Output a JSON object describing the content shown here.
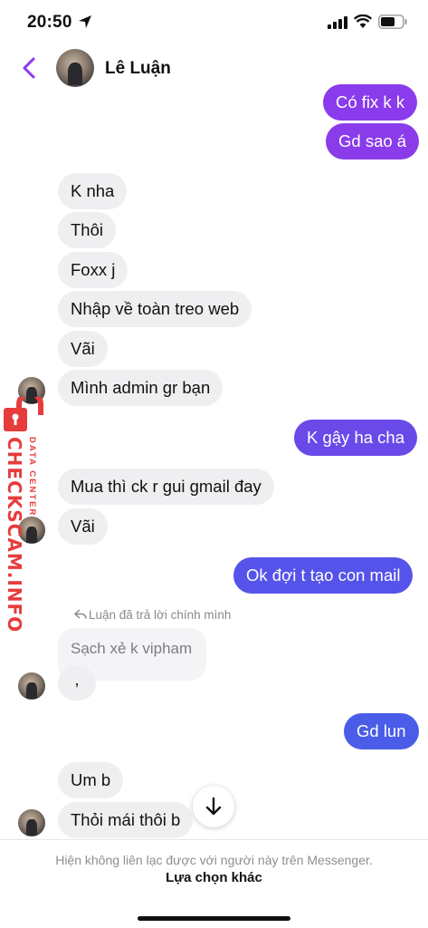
{
  "status_bar": {
    "time": "20:50"
  },
  "header": {
    "contact_name": "Lê Luận"
  },
  "colors": {
    "accent": "#7b3fe4",
    "outgoing_top": "#8a3bec",
    "outgoing_bottom": "#4a5ce8",
    "incoming": "#efeff1"
  },
  "messages": [
    {
      "dir": "out",
      "text": "Có fix k k"
    },
    {
      "dir": "out",
      "text": "Gd sao á"
    },
    {
      "dir": "in",
      "text": "K nha"
    },
    {
      "dir": "in",
      "text": "Thôi"
    },
    {
      "dir": "in",
      "text": "Foxx j"
    },
    {
      "dir": "in",
      "text": "Nhập về toàn treo web"
    },
    {
      "dir": "in",
      "text": "Vãi"
    },
    {
      "dir": "in",
      "text": "Mình admin gr bạn"
    },
    {
      "dir": "out",
      "text": "K gậy ha cha"
    },
    {
      "dir": "in",
      "text": "Mua thì ck r gui gmail đay"
    },
    {
      "dir": "in",
      "text": "Vãi"
    },
    {
      "dir": "out",
      "text": "Ok đợi t tạo con mail"
    },
    {
      "dir": "out",
      "text": "Gd lun"
    },
    {
      "dir": "in",
      "text": "Um b"
    },
    {
      "dir": "in",
      "text": "Thỏi mái thôi b"
    }
  ],
  "reply": {
    "note": "Luận đã trả lời chính mình",
    "quoted_text": "Sạch xẻ k vipham",
    "reply_text": ","
  },
  "watermark": {
    "main": "CHECKSCAM.INFO",
    "sub": "DATA CENTER"
  },
  "footer": {
    "note": "Hiện không liên lạc được với người này trên Messenger.",
    "action": "Lựa chọn khác"
  },
  "icons": [
    "location-arrow-icon",
    "signal-icon",
    "wifi-icon",
    "battery-icon",
    "back-chevron-icon",
    "reply-arrow-icon",
    "arrow-down-icon",
    "lock-icon"
  ]
}
